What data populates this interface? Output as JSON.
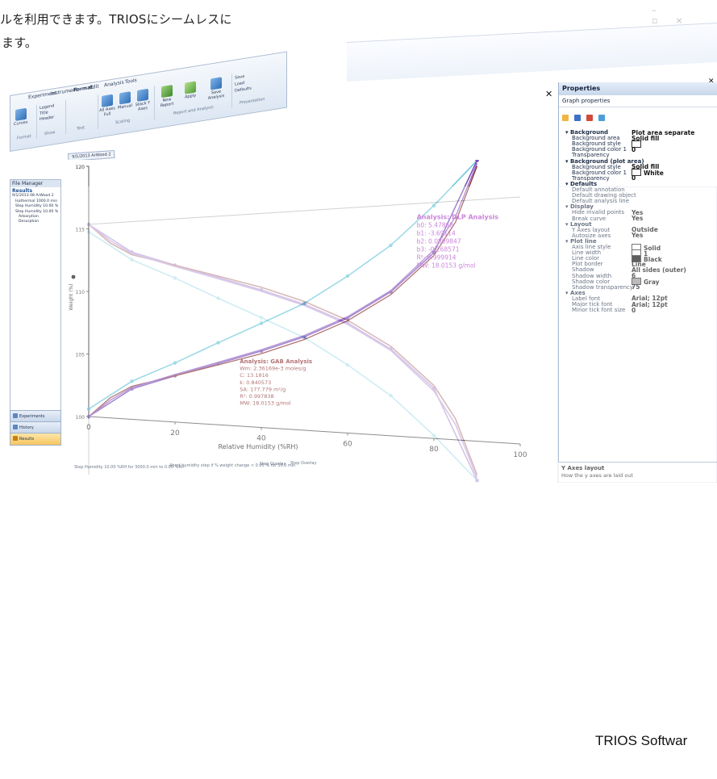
{
  "intro_text": {
    "line1": "ルを利用できます。TRIOSにシームレスに",
    "line2": "ます。"
  },
  "caption": "TRIOS Softwar",
  "window_controls": [
    "–",
    "▫",
    "×"
  ],
  "ribbon": {
    "tabs": [
      "Experiment",
      "Instrument",
      "Format",
      "Edit",
      "Analysis",
      "Tools"
    ],
    "buttons": [
      "Curves",
      "Legend",
      "Title",
      "Header",
      "All Axes Full",
      "Manual",
      "Stack Y Axes",
      "New Report",
      "Apply",
      "Save Analysis",
      "Save",
      "Load",
      "Defaults"
    ],
    "groups": [
      "Format",
      "Show",
      "Text",
      "Scaling",
      "Report and Analysis",
      "Presentation"
    ]
  },
  "file_manager": {
    "title": "File Manager",
    "results_label": "Results",
    "tree": [
      "9/1/2013 08 ArWood 2",
      "Isothermal 1000.0 min",
      "Step Humidity 10.00 %",
      "Step Humidity 10.00 %",
      "Adsorption",
      "Desorption"
    ]
  },
  "nav": {
    "experiments": "Experiments",
    "history": "History",
    "results": "Results"
  },
  "document_tab": "9/1/2013 ArWood 2",
  "chart_data": {
    "type": "line",
    "xlabel": "Relative Humidity (%RH)",
    "ylabel": "Weight (%)",
    "xlim": [
      0,
      100
    ],
    "ylim": [
      100,
      120
    ],
    "x_ticks": [
      0,
      20,
      40,
      60,
      80,
      100
    ],
    "y_ticks": [
      100,
      105,
      110,
      115,
      120
    ],
    "series": [
      {
        "color": "#6ec9dc",
        "x": [
          0,
          10,
          20,
          30,
          40,
          50,
          60,
          70,
          80,
          90
        ],
        "y": [
          100.6,
          103.0,
          104.6,
          106.3,
          107.9,
          109.5,
          111.6,
          113.9,
          116.8,
          120.0
        ]
      },
      {
        "color": "#7b52b9",
        "x": [
          0,
          10,
          20,
          30,
          40,
          50,
          60,
          70,
          80,
          90
        ],
        "y": [
          100.0,
          102.4,
          103.6,
          104.7,
          105.8,
          107.0,
          108.5,
          110.5,
          113.4,
          120.0
        ]
      },
      {
        "color": "#8c2f2f",
        "x": [
          0,
          5,
          10,
          20,
          30,
          40,
          50,
          60,
          70,
          80,
          85,
          90
        ],
        "y": [
          100.0,
          101.6,
          102.6,
          103.6,
          104.6,
          105.6,
          106.8,
          108.3,
          110.3,
          113.2,
          115.6,
          119.6
        ]
      },
      {
        "color": "#8e5fc0",
        "x": [
          0,
          5,
          10,
          20,
          30,
          40,
          50,
          60,
          70,
          80,
          85,
          90
        ],
        "y": [
          100.0,
          101.4,
          102.5,
          103.7,
          104.8,
          105.9,
          107.1,
          108.6,
          110.6,
          113.6,
          116.0,
          119.8
        ]
      }
    ],
    "annotations": [
      {
        "title": "Analysis: GAB Analysis",
        "color": "#8c2f2f",
        "x": 35,
        "y": 104.8,
        "lines": [
          "Wm: 2.36169e-3 moles/g",
          "C: 13.1816",
          "k: 0.840573",
          "SA: 177.779 m²/g",
          "R²: 0.997838",
          "MW: 18.0153 g/mol"
        ]
      },
      {
        "title": "Analysis: DLP Analysis",
        "color": "#b048c8",
        "x": 76,
        "y": 115.8,
        "lines": [
          "b0: 5.47868",
          "b1: -3.69114",
          "b2: 0.0809847",
          "b3: -0.268571",
          "R²: 0.999914",
          "MW: 18.0153 g/mol"
        ]
      }
    ]
  },
  "status_bar": [
    "Step Humidity 10.00 %RH for 3000.0 min to 0.00 %RH",
    "Abort humidity step if % weight change < 0.05 % for 30.0 min",
    "Step Overlay",
    "Step Overlay"
  ],
  "properties": {
    "title": "Properties",
    "subtitle": "Graph properties",
    "rows": [
      {
        "type": "cat",
        "label": "Background",
        "value": "Plot area separate"
      },
      {
        "type": "row",
        "label": "Background area",
        "value": "Solid fill"
      },
      {
        "type": "row",
        "label": "Background style",
        "value": "",
        "swatch": "#ffffff"
      },
      {
        "type": "row",
        "label": "Background color 1",
        "value": "0"
      },
      {
        "type": "row",
        "label": "Transparency",
        "value": ""
      },
      {
        "type": "cat",
        "label": "Background (plot area)",
        "value": ""
      },
      {
        "type": "row",
        "label": "Background style",
        "value": "Solid fill"
      },
      {
        "type": "row",
        "label": "Background color 1",
        "value": "White",
        "swatch": "#ffffff"
      },
      {
        "type": "row",
        "label": "Transparency",
        "value": "0"
      },
      {
        "type": "cat",
        "label": "Defaults",
        "value": ""
      },
      {
        "type": "row",
        "label": "Default annotation",
        "value": ""
      },
      {
        "type": "row",
        "label": "Default drawing object",
        "value": ""
      },
      {
        "type": "row",
        "label": "Default analysis line",
        "value": ""
      },
      {
        "type": "cat",
        "label": "Display",
        "value": ""
      },
      {
        "type": "row",
        "label": "Hide invalid points",
        "value": "Yes"
      },
      {
        "type": "row",
        "label": "Break curve",
        "value": "Yes"
      },
      {
        "type": "cat",
        "label": "Layout",
        "value": ""
      },
      {
        "type": "row",
        "label": "Y Axes layout",
        "value": "Outside"
      },
      {
        "type": "row",
        "label": "Autosize axes",
        "value": "Yes"
      },
      {
        "type": "cat",
        "label": "Plot line",
        "value": ""
      },
      {
        "type": "row",
        "label": "Axis line style",
        "value": "Solid",
        "swatch": "#ffffff"
      },
      {
        "type": "row",
        "label": "Line width",
        "value": "1",
        "swatch": "#ffffff"
      },
      {
        "type": "row",
        "label": "Line color",
        "value": "Black",
        "swatch": "#111111"
      },
      {
        "type": "row",
        "label": "Plot border",
        "value": "Line"
      },
      {
        "type": "row",
        "label": "Shadow",
        "value": "All sides (outer)"
      },
      {
        "type": "row",
        "label": "Shadow width",
        "value": "6"
      },
      {
        "type": "row",
        "label": "Shadow color",
        "value": "Gray",
        "swatch": "#9a9a9a"
      },
      {
        "type": "row",
        "label": "Shadow transparency",
        "value": "75"
      },
      {
        "type": "cat",
        "label": "Axes",
        "value": ""
      },
      {
        "type": "row",
        "label": "Label font",
        "value": "Arial; 12pt"
      },
      {
        "type": "row",
        "label": "Major tick font",
        "value": "Arial; 12pt"
      },
      {
        "type": "row",
        "label": "Minor tick font size",
        "value": "0"
      }
    ],
    "desc_title": "Y Axes layout",
    "desc_text": "How the y axes are laid out"
  },
  "colors": {
    "accent": "#2f6fb6",
    "panel_border": "#9fb2cc"
  }
}
